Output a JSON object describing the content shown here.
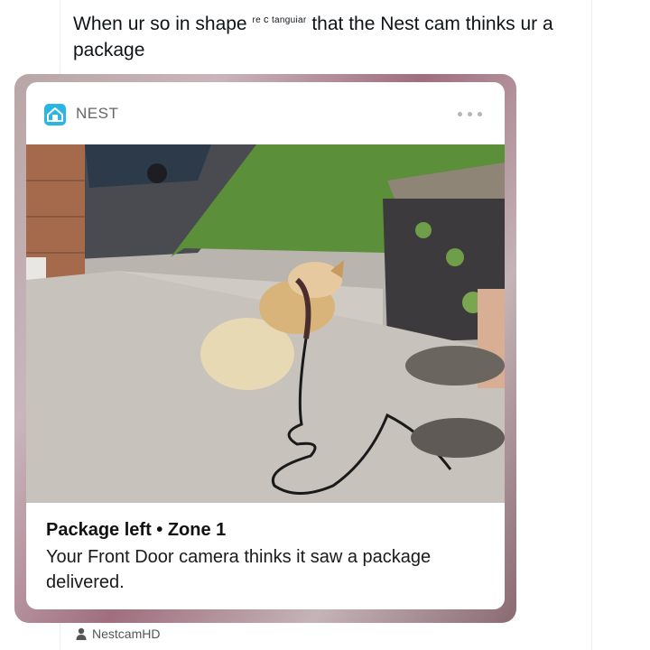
{
  "post": {
    "caption_start": "When ur so in shape",
    "caption_sup_a": "re",
    "caption_sup_b": "c",
    "caption_sup_c": "tanguiar",
    "caption_end": "that the Nest cam thinks ur a package"
  },
  "notification": {
    "app_name": "NEST",
    "app_icon": "nest-home-icon",
    "menu_icon": "more-dots-icon",
    "title": "Package left • Zone 1",
    "body": "Your Front Door camera thinks it saw a package delivered."
  },
  "credit": {
    "icon": "person-icon",
    "name": "NestcamHD"
  },
  "colors": {
    "nest_brand": "#2ab6e5",
    "lawn": "#5c8f3a",
    "porch": "#c7c2bb"
  }
}
